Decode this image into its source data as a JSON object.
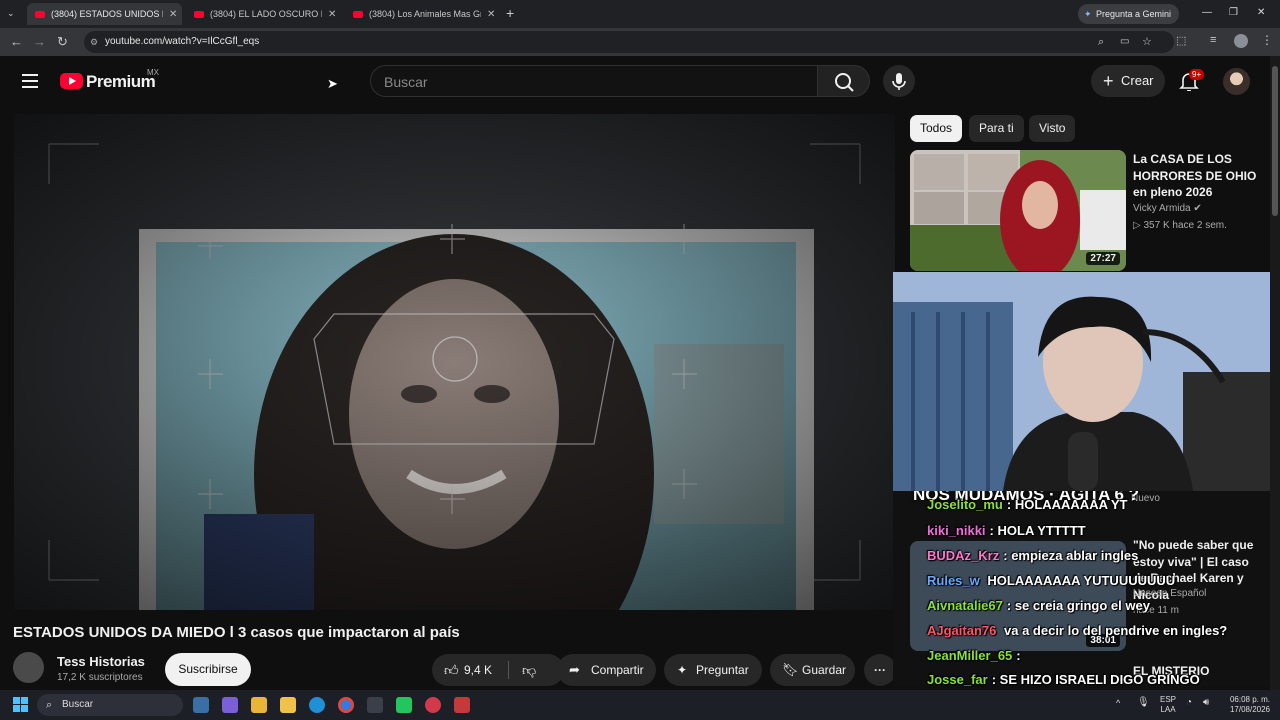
{
  "browser": {
    "tabs": [
      {
        "label": "(3804) ESTADOS UNIDOS DA M",
        "active": true
      },
      {
        "label": "(3804) EL LADO OSCURO DE LO",
        "active": false
      },
      {
        "label": "(3804) Los Animales Mas Grand",
        "active": false
      }
    ],
    "new_tab": "+",
    "url": "youtube.com/watch?v=IlCcGfl_eqs",
    "gemini_button": "Pregunta a Gemini"
  },
  "youtube_header": {
    "logo_text": "Premium",
    "region": "MX",
    "search_placeholder": "Buscar",
    "create_label": "Crear",
    "notifications_badge": "9+"
  },
  "video": {
    "title": "ESTADOS UNIDOS DA MIEDO l 3 casos que impactaron al país",
    "channel": "Tess Historias",
    "subscribers": "17,2 K suscriptores",
    "subscribe_label": "Suscribirse",
    "likes": "9,4 K",
    "share_label": "Compartir",
    "ask_label": "Preguntar",
    "save_label": "Guardar"
  },
  "filter_chips": [
    {
      "label": "Todos",
      "active": true
    },
    {
      "label": "Para ti",
      "active": false
    },
    {
      "label": "Visto",
      "active": false
    }
  ],
  "recommendations": [
    {
      "title": "La CASA DE LOS HORRORES DE OHIO en pleno 2026",
      "channel": "Vicky Armida",
      "views": "357 K",
      "age": "hace 2 sem.",
      "duration": "27:27"
    },
    {
      "title": "\"No puede saber que estoy viva\" | El caso de Rachael Karen y Nicola",
      "channel": "Unseen Español",
      "views": "",
      "age": "hace 11 m",
      "duration": "38:01",
      "badge": "Nuevo"
    },
    {
      "title": "EL MISTERIO"
    }
  ],
  "overlay": {
    "banner": "NOS MUDAMOS · AGITA 6 ?",
    "chat": [
      {
        "user": "Joselito_mu",
        "message": "HOLAAAAAAA YT",
        "color": "#8ae234"
      },
      {
        "user": "kiki_nikki",
        "message": "HOLA YTTTTT",
        "color": "#f06fd6"
      },
      {
        "user": "BUDAz_Krz",
        "message": "empieza ablar ingles",
        "color": "#ff77cc"
      },
      {
        "user": "Rules_w",
        "message": "HOLAAAAAAA YUTUUUUUUU",
        "color": "#66aaff"
      },
      {
        "user": "Aivnatalie67",
        "message": "se creia gringo el wey",
        "color": "#8ae234"
      },
      {
        "user": "AJgaitan76",
        "message": "va a decir lo del pendrive en ingles?",
        "color": "#ff5566"
      },
      {
        "user": "JeanMiller_65",
        "message": "",
        "color": "#8ae234"
      },
      {
        "user": "Josse_far",
        "message": "SE HIZO ISRAELI DIGO GRINGO",
        "color": "#8ae234"
      }
    ]
  },
  "taskbar": {
    "search_label": "Buscar",
    "language": "ESP",
    "keyboard": "LAA",
    "time": "06:08 p. m.",
    "date": "17/08/2026"
  }
}
